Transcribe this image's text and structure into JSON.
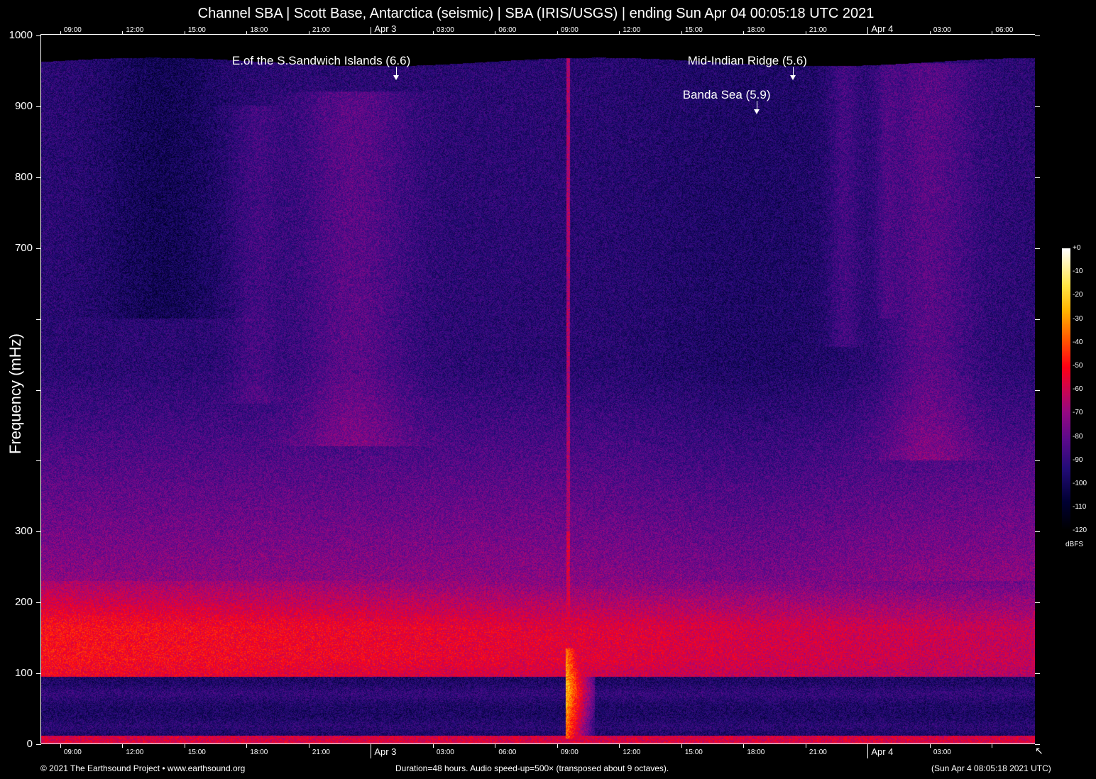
{
  "chart_data": {
    "type": "heatmap",
    "title": "Channel SBA | Scott Base, Antarctica (seismic) | SBA (IRIS/USGS) | ending Sun Apr 04 00:05:18 UTC 2021",
    "ylabel": "Frequency (mHz)",
    "ylim": [
      0,
      1000
    ],
    "xlim_hours": [
      0,
      48
    ],
    "y_ticks": [
      {
        "value": 1000,
        "label": "1000"
      },
      {
        "value": 900,
        "label": "900"
      },
      {
        "value": 800,
        "label": "800"
      },
      {
        "value": 700,
        "label": "700"
      },
      {
        "value": 600,
        "label": ""
      },
      {
        "value": 500,
        "label": ""
      },
      {
        "value": 400,
        "label": ""
      },
      {
        "value": 300,
        "label": "300"
      },
      {
        "value": 200,
        "label": "200"
      },
      {
        "value": 100,
        "label": "100"
      },
      {
        "value": 0,
        "label": "0"
      }
    ],
    "x_ticks_top": [
      {
        "hour": 0.92,
        "label": "09:00"
      },
      {
        "hour": 3.92,
        "label": "12:00"
      },
      {
        "hour": 6.92,
        "label": "15:00"
      },
      {
        "hour": 9.92,
        "label": "18:00"
      },
      {
        "hour": 12.92,
        "label": "21:00"
      },
      {
        "hour": 15.92,
        "label": "Apr  3",
        "day": true
      },
      {
        "hour": 18.92,
        "label": "03:00"
      },
      {
        "hour": 21.92,
        "label": "06:00"
      },
      {
        "hour": 24.92,
        "label": "09:00"
      },
      {
        "hour": 27.92,
        "label": "12:00"
      },
      {
        "hour": 30.92,
        "label": "15:00"
      },
      {
        "hour": 33.92,
        "label": "18:00"
      },
      {
        "hour": 36.92,
        "label": "21:00"
      },
      {
        "hour": 39.92,
        "label": "Apr  4",
        "day": true
      },
      {
        "hour": 42.92,
        "label": "03:00"
      },
      {
        "hour": 45.92,
        "label": "06:00"
      }
    ],
    "x_ticks_bottom": [
      {
        "hour": 0.92,
        "label": "09:00"
      },
      {
        "hour": 3.92,
        "label": "12:00"
      },
      {
        "hour": 6.92,
        "label": "15:00"
      },
      {
        "hour": 9.92,
        "label": "18:00"
      },
      {
        "hour": 12.92,
        "label": "21:00"
      },
      {
        "hour": 15.92,
        "label": "Apr  3",
        "day": true
      },
      {
        "hour": 18.92,
        "label": "03:00"
      },
      {
        "hour": 21.92,
        "label": "06:00"
      },
      {
        "hour": 24.92,
        "label": "09:00"
      },
      {
        "hour": 27.92,
        "label": "12:00"
      },
      {
        "hour": 30.92,
        "label": "15:00"
      },
      {
        "hour": 33.92,
        "label": "18:00"
      },
      {
        "hour": 36.92,
        "label": "21:00"
      },
      {
        "hour": 39.92,
        "label": "Apr  4",
        "day": true
      },
      {
        "hour": 42.92,
        "label": "03:00"
      },
      {
        "hour": 45.92,
        "label": ""
      }
    ],
    "annotations": [
      {
        "label": "E.of the S.Sandwich Islands (6.6)",
        "hour": 17.14,
        "row": 0
      },
      {
        "label": "Mid-Indian Ridge (5.6)",
        "hour": 36.3,
        "row": 0
      },
      {
        "label": "Banda Sea (5.9)",
        "hour": 34.55,
        "row": 1
      }
    ],
    "colorbar": {
      "unit": "dBFS",
      "range": [
        -120,
        0
      ],
      "ticks": [
        "+0",
        "-10",
        "-20",
        "-30",
        "-40",
        "-50",
        "-60",
        "-70",
        "-80",
        "-90",
        "-100",
        "-110",
        "-120"
      ]
    },
    "colors": {
      "background": "#000000",
      "text": "#ffffff"
    }
  },
  "footer": {
    "copyright": "© 2021 The Earthsound Project • www.earthsound.org",
    "info": "Duration=48 hours. Audio speed-up=500× (transposed about 9 octaves).",
    "timestamp": "(Sun Apr  4 08:05:18 2021 UTC)"
  }
}
